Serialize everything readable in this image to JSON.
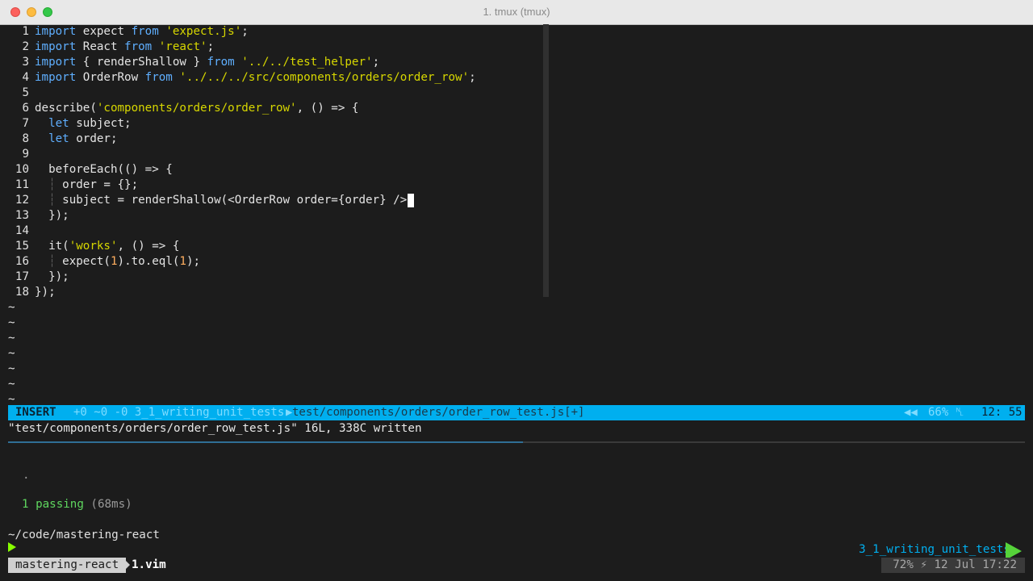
{
  "window": {
    "title": "1. tmux (tmux)"
  },
  "editor": {
    "lines": [
      {
        "n": "1",
        "segs": [
          [
            "kw",
            "import"
          ],
          [
            "p",
            " expect "
          ],
          [
            "kw",
            "from"
          ],
          [
            "p",
            " "
          ],
          [
            "str",
            "'expect.js'"
          ],
          [
            "p",
            ";"
          ]
        ]
      },
      {
        "n": "2",
        "segs": [
          [
            "kw",
            "import"
          ],
          [
            "p",
            " React "
          ],
          [
            "kw",
            "from"
          ],
          [
            "p",
            " "
          ],
          [
            "str",
            "'react'"
          ],
          [
            "p",
            ";"
          ]
        ]
      },
      {
        "n": "3",
        "segs": [
          [
            "kw",
            "import"
          ],
          [
            "p",
            " { renderShallow } "
          ],
          [
            "kw",
            "from"
          ],
          [
            "p",
            " "
          ],
          [
            "str",
            "'../../test_helper'"
          ],
          [
            "p",
            ";"
          ]
        ]
      },
      {
        "n": "4",
        "segs": [
          [
            "kw",
            "import"
          ],
          [
            "p",
            " OrderRow "
          ],
          [
            "kw",
            "from"
          ],
          [
            "p",
            " "
          ],
          [
            "str",
            "'../../../src/components/orders/order_row'"
          ],
          [
            "p",
            ";"
          ]
        ]
      },
      {
        "n": "5",
        "segs": []
      },
      {
        "n": "6",
        "segs": [
          [
            "p",
            "describe("
          ],
          [
            "str",
            "'components/orders/order_row'"
          ],
          [
            "p",
            ", () => {"
          ]
        ]
      },
      {
        "n": "7",
        "segs": [
          [
            "p",
            "  "
          ],
          [
            "kw",
            "let"
          ],
          [
            "p",
            " subject;"
          ]
        ]
      },
      {
        "n": "8",
        "segs": [
          [
            "p",
            "  "
          ],
          [
            "kw",
            "let"
          ],
          [
            "p",
            " order;"
          ]
        ]
      },
      {
        "n": "9",
        "segs": []
      },
      {
        "n": "10",
        "segs": [
          [
            "p",
            "  beforeEach(() => {"
          ]
        ]
      },
      {
        "n": "11",
        "segs": [
          [
            "p",
            "  "
          ],
          [
            "guide",
            "┆"
          ],
          [
            "p",
            " order = {};"
          ]
        ]
      },
      {
        "n": "12",
        "segs": [
          [
            "p",
            "  "
          ],
          [
            "guide",
            "┆"
          ],
          [
            "p",
            " subject = renderShallow(<OrderRow order={order} />"
          ]
        ],
        "cursor": true
      },
      {
        "n": "13",
        "segs": [
          [
            "p",
            "  });"
          ]
        ]
      },
      {
        "n": "14",
        "segs": []
      },
      {
        "n": "15",
        "segs": [
          [
            "p",
            "  it("
          ],
          [
            "str",
            "'works'"
          ],
          [
            "p",
            ", () => {"
          ]
        ]
      },
      {
        "n": "16",
        "segs": [
          [
            "p",
            "  "
          ],
          [
            "guide",
            "┆"
          ],
          [
            "p",
            " expect("
          ],
          [
            "num",
            "1"
          ],
          [
            "p",
            ").to.eql("
          ],
          [
            "num",
            "1"
          ],
          [
            "p",
            ");"
          ]
        ]
      },
      {
        "n": "17",
        "segs": [
          [
            "p",
            "  });"
          ]
        ]
      },
      {
        "n": "18",
        "segs": [
          [
            "p",
            "});"
          ]
        ]
      }
    ],
    "tildes": [
      "~",
      "~",
      "~",
      "~",
      "~",
      "~",
      "~"
    ]
  },
  "statusline": {
    "mode": "INSERT",
    "git": "+0 ~0 -0 3_1_writing_unit_tests",
    "file": "test/components/orders/order_row_test.js[+]",
    "percent": "66% ␤",
    "position": "12: 55"
  },
  "cmdline": "\"test/components/orders/order_row_test.js\" 16L, 338C written",
  "shell": {
    "dot": ".",
    "passing_count": "1 passing",
    "passing_time": " (68ms)",
    "cwd": "~/code/mastering-react"
  },
  "tmux": {
    "session": "mastering-react",
    "window": "1.vim",
    "branch": "3_1_writing_unit_tests",
    "right_status": "72% ⚡ 12 Jul 17:22"
  },
  "colors": {
    "accent": "#00afef",
    "keyword": "#5fafff",
    "string": "#d7d700",
    "number": "#ffaf5f",
    "prompt": "#87ff00"
  }
}
